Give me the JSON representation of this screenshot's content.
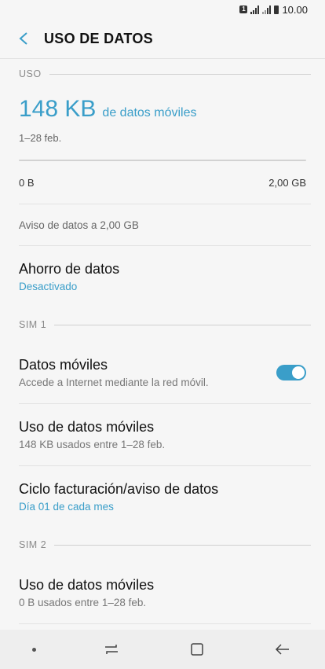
{
  "status": {
    "sim_badge": "1",
    "time": "10.00"
  },
  "appbar": {
    "title": "USO DE DATOS"
  },
  "usage": {
    "section_label": "USO",
    "value": "148 KB",
    "unit": "de datos móviles",
    "date_range": "1–28 feb.",
    "bar_fraction": 0.0001,
    "min_label": "0 B",
    "max_label": "2,00 GB",
    "warning": "Aviso de datos a 2,00 GB"
  },
  "data_saver": {
    "title": "Ahorro de datos",
    "subtitle": "Desactivado"
  },
  "sim1": {
    "section_label": "SIM 1",
    "mobile_data": {
      "title": "Datos móviles",
      "subtitle": "Accede a Internet mediante la red móvil.",
      "enabled": true
    },
    "usage": {
      "title": "Uso de datos móviles",
      "subtitle": "148 KB usados entre 1–28 feb."
    },
    "billing": {
      "title": "Ciclo facturación/aviso de datos",
      "subtitle": "Día 01 de cada mes"
    }
  },
  "sim2": {
    "section_label": "SIM 2",
    "usage": {
      "title": "Uso de datos móviles",
      "subtitle": "0 B usados entre 1–28 feb."
    }
  },
  "colors": {
    "accent": "#3a9ec9",
    "background": "#f6f6f6"
  },
  "icons": {
    "back": "back-arrow-icon",
    "recents": "recents-icon",
    "home": "home-icon",
    "nav_back": "nav-back-icon"
  }
}
